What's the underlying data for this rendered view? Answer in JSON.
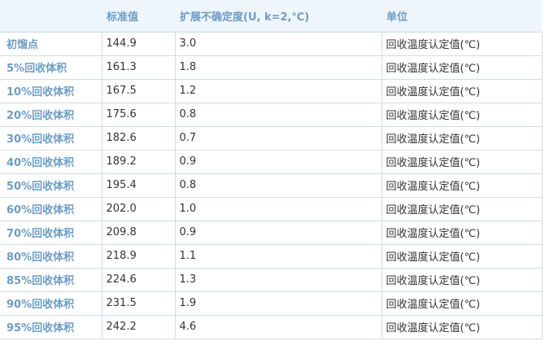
{
  "table": {
    "headers": [
      "",
      "标准值",
      "扩展不确定度(U, k=2,℃)",
      "单位"
    ],
    "rows": [
      {
        "label": "初馏点",
        "value": "144.9",
        "uncertainty": "3.0",
        "unit": "回收温度认定值(℃)"
      },
      {
        "label": "5%回收体积",
        "value": "161.3",
        "uncertainty": "1.8",
        "unit": "回收温度认定值(℃)"
      },
      {
        "label": "10%回收体积",
        "value": "167.5",
        "uncertainty": "1.2",
        "unit": "回收温度认定值(℃)"
      },
      {
        "label": "20%回收体积",
        "value": "175.6",
        "uncertainty": "0.8",
        "unit": "回收温度认定值(℃)"
      },
      {
        "label": "30%回收体积",
        "value": "182.6",
        "uncertainty": "0.7",
        "unit": "回收温度认定值(℃)"
      },
      {
        "label": "40%回收体积",
        "value": "189.2",
        "uncertainty": "0.9",
        "unit": "回收温度认定值(℃)"
      },
      {
        "label": "50%回收体积",
        "value": "195.4",
        "uncertainty": "0.8",
        "unit": "回收温度认定值(℃)"
      },
      {
        "label": "60%回收体积",
        "value": "202.0",
        "uncertainty": "1.0",
        "unit": "回收温度认定值(℃)"
      },
      {
        "label": "70%回收体积",
        "value": "209.8",
        "uncertainty": "0.9",
        "unit": "回收温度认定值(℃)"
      },
      {
        "label": "80%回收体积",
        "value": "218.9",
        "uncertainty": "1.1",
        "unit": "回收温度认定值(℃)"
      },
      {
        "label": "85%回收体积",
        "value": "224.6",
        "uncertainty": "1.3",
        "unit": "回收温度认定值(℃)"
      },
      {
        "label": "90%回收体积",
        "value": "231.5",
        "uncertainty": "1.9",
        "unit": "回收温度认定值(℃)"
      },
      {
        "label": "95%回收体积",
        "value": "242.2",
        "uncertainty": "4.6",
        "unit": "回收温度认定值(℃)"
      }
    ]
  },
  "colors": {
    "header_background": "#eef5fb",
    "accent_text": "#6e9cc4",
    "grid_line": "#cfdbe6",
    "body_text": "#333333"
  }
}
